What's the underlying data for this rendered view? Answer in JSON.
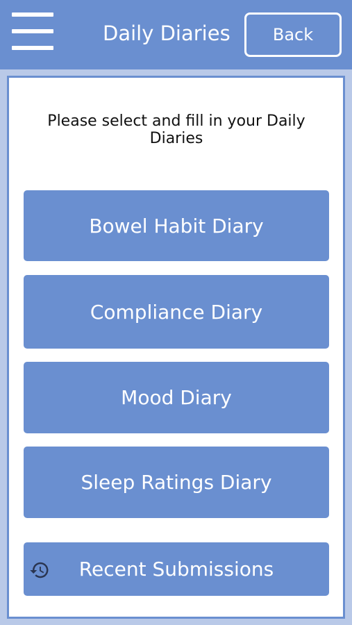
{
  "header": {
    "title": "Daily Diaries",
    "back_label": "Back",
    "menu_icon": "hamburger-menu-icon"
  },
  "main": {
    "instruction": "Please select and fill in your Daily Diaries",
    "diaries": [
      {
        "label": "Bowel Habit Diary"
      },
      {
        "label": "Compliance Diary"
      },
      {
        "label": "Mood Diary"
      },
      {
        "label": "Sleep Ratings Diary"
      }
    ],
    "recent": {
      "label": "Recent Submissions",
      "icon": "history-icon"
    }
  },
  "colors": {
    "primary": "#6a8fd0",
    "background": "#b9c9e8",
    "panel": "#ffffff",
    "text_on_primary": "#ffffff",
    "icon_dark": "#2a3550"
  }
}
